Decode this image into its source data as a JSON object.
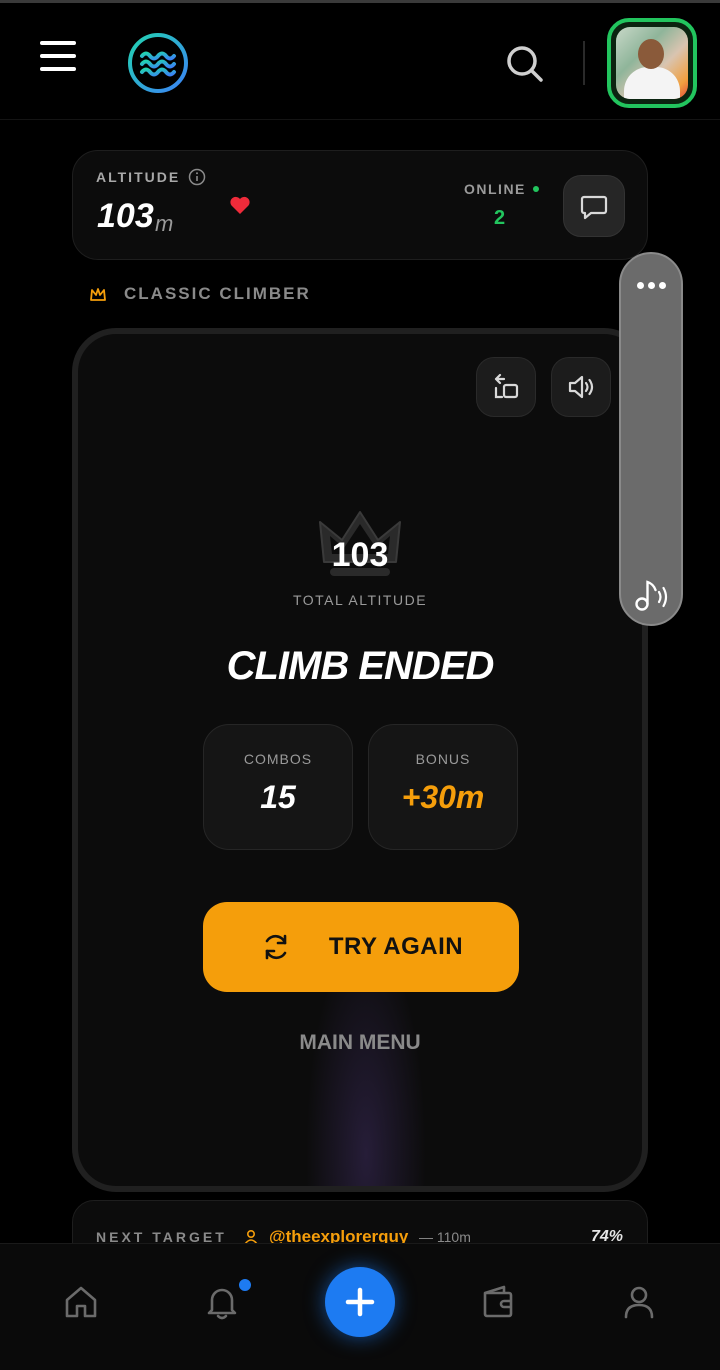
{
  "header": {
    "menu_icon": "hamburger-icon",
    "logo_icon": "wave-logo-icon",
    "search_icon": "search-icon",
    "avatar_icon": "user-avatar"
  },
  "altitude_card": {
    "label": "ALTITUDE",
    "value": "103",
    "unit": "m",
    "online_label": "ONLINE",
    "online_count": "2"
  },
  "mode": {
    "label": "CLASSIC CLIMBER",
    "icon": "crown-outline-icon"
  },
  "game": {
    "score": "103",
    "score_label": "TOTAL ALTITUDE",
    "title": "CLIMB ENDED",
    "stats": [
      {
        "label": "COMBOS",
        "value": "15",
        "color": "#ffffff"
      },
      {
        "label": "BONUS",
        "value": "+30m",
        "color": "#f59e0b"
      }
    ],
    "try_again_label": "TRY AGAIN",
    "main_menu_label": "MAIN MENU"
  },
  "next_target": {
    "label": "NEXT TARGET",
    "user": "@theexplorerguy",
    "distance": "— 110m",
    "percent": "74%"
  },
  "bottom_nav": {
    "items": [
      "home-icon",
      "bell-icon",
      "plus-icon",
      "wallet-icon",
      "profile-icon"
    ],
    "notification_badge": true
  },
  "colors": {
    "accent": "#f59e0b",
    "online": "#22c55e",
    "primary_blue": "#1d7bf2",
    "heart": "#ef2b3a"
  }
}
